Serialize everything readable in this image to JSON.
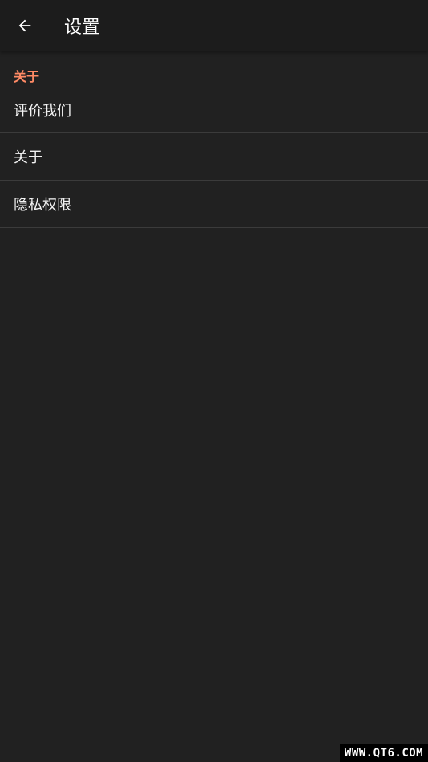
{
  "app_bar": {
    "back_icon": "arrow-left-icon",
    "title": "设置"
  },
  "section": {
    "header": "关于",
    "items": [
      {
        "label": "评价我们"
      },
      {
        "label": "关于"
      },
      {
        "label": "隐私权限"
      }
    ]
  },
  "watermark": "WWW.QT6.COM",
  "colors": {
    "background": "#212121",
    "app_bar": "#1c1c1c",
    "accent": "#ff8a65",
    "divider": "#3b3b3b",
    "text": "#ffffff"
  }
}
